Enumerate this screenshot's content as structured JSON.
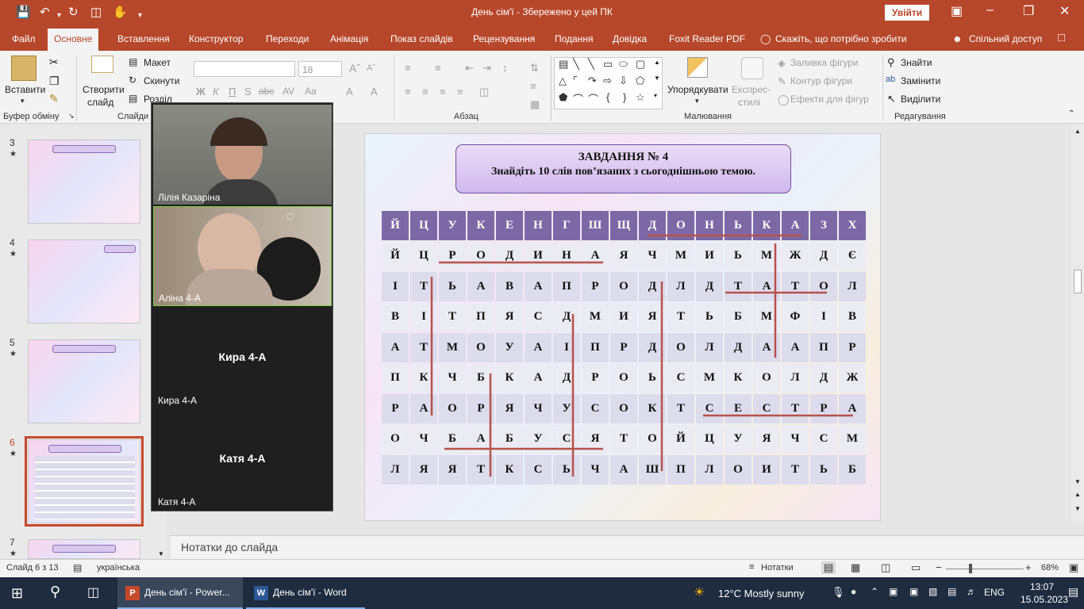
{
  "titlebar": {
    "title": "День сім'ї  -  Збережено у цей ПК",
    "signin_label": "Увійти"
  },
  "ribbon_tabs": [
    {
      "label": "Файл"
    },
    {
      "label": "Основне"
    },
    {
      "label": "Вставлення"
    },
    {
      "label": "Конструктор"
    },
    {
      "label": "Переходи"
    },
    {
      "label": "Анімація"
    },
    {
      "label": "Показ слайдів"
    },
    {
      "label": "Рецензування"
    },
    {
      "label": "Подання"
    },
    {
      "label": "Довідка"
    },
    {
      "label": "Foxit Reader PDF"
    },
    {
      "label": "Скажіть, що потрібно зробити"
    },
    {
      "label": "Спільний доступ"
    }
  ],
  "ribbon": {
    "paste": "Вставити",
    "clipboard_group": "Буфер обміну",
    "new_slide_1": "Створити",
    "new_slide_2": "слайд",
    "layout": "Макет",
    "reset": "Скинути",
    "section": "Розділ",
    "slides_group": "Слайди",
    "font_size": "18",
    "paragraph_group": "Абзац",
    "arrange": "Упорядкувати",
    "quick_styles_1": "Експрес-",
    "quick_styles_2": "стилі",
    "shape_fill": "Заливка фігури",
    "shape_outline": "Контур фігури",
    "shape_effects": "Ефекти для фігур",
    "drawing_group": "Малювання",
    "find": "Знайти",
    "replace": "Замінити",
    "select": "Виділити",
    "editing_group": "Редагування"
  },
  "thumbnails": [
    {
      "num": "3",
      "selected": false
    },
    {
      "num": "4",
      "selected": false
    },
    {
      "num": "5",
      "selected": false
    },
    {
      "num": "6",
      "selected": true
    },
    {
      "num": "7",
      "selected": false
    }
  ],
  "video": {
    "participants": [
      {
        "name": "Лілія Казаріна",
        "camera": true
      },
      {
        "name": "Аліна 4-А",
        "camera": true
      },
      {
        "name": "Кира 4-А",
        "center": "Кира 4-А",
        "camera": false
      },
      {
        "name": "Катя  4-А",
        "center": "Катя  4-А",
        "camera": false
      }
    ]
  },
  "slide": {
    "task_title": "ЗАВДАННЯ № 4",
    "task_subtitle": "Знайдіть 10 слів пов’язаних з сьогоднішньою темою.",
    "grid": [
      [
        "Й",
        "Ц",
        "У",
        "К",
        "Е",
        "Н",
        "Г",
        "Ш",
        "Щ",
        "Д",
        "О",
        "Н",
        "Ь",
        "К",
        "А",
        "З",
        "Х"
      ],
      [
        "Й",
        "Ц",
        "Р",
        "О",
        "Д",
        "И",
        "Н",
        "А",
        "Я",
        "Ч",
        "М",
        "И",
        "Ь",
        "М",
        "Ж",
        "Д",
        "Є"
      ],
      [
        "І",
        "Т",
        "Ь",
        "А",
        "В",
        "А",
        "П",
        "Р",
        "О",
        "Д",
        "Л",
        "Д",
        "Т",
        "А",
        "Т",
        "О",
        "Л"
      ],
      [
        "В",
        "І",
        "Т",
        "П",
        "Я",
        "С",
        "Д",
        "М",
        "И",
        "Я",
        "Т",
        "Ь",
        "Б",
        "М",
        "Ф",
        "І",
        "В"
      ],
      [
        "А",
        "Т",
        "М",
        "О",
        "У",
        "А",
        "І",
        "П",
        "Р",
        "Д",
        "О",
        "Л",
        "Д",
        "А",
        "А",
        "П",
        "Р"
      ],
      [
        "П",
        "К",
        "Ч",
        "Б",
        "К",
        "А",
        "Д",
        "Р",
        "О",
        "Ь",
        "С",
        "М",
        "К",
        "О",
        "Л",
        "Д",
        "Ж"
      ],
      [
        "Р",
        "А",
        "О",
        "Р",
        "Я",
        "Ч",
        "У",
        "С",
        "О",
        "К",
        "Т",
        "С",
        "Е",
        "С",
        "Т",
        "Р",
        "А"
      ],
      [
        "О",
        "Ч",
        "Б",
        "А",
        "Б",
        "У",
        "С",
        "Я",
        "Т",
        "О",
        "Й",
        "Ц",
        "У",
        "Я",
        "Ч",
        "С",
        "М"
      ],
      [
        "Л",
        "Я",
        "Я",
        "Т",
        "К",
        "С",
        "Ь",
        "Ч",
        "А",
        "Ш",
        "П",
        "Л",
        "О",
        "И",
        "Т",
        "Ь",
        "Б"
      ]
    ],
    "line_color": "#b5524d"
  },
  "notes": {
    "placeholder": "Нотатки до слайда"
  },
  "statusbar": {
    "slide_info": "Слайд 6 з 13",
    "language": "українська",
    "notes_label": "Нотатки",
    "zoom": "68%"
  },
  "taskbar": {
    "apps": [
      {
        "label": "День сім'ї - Power...",
        "icon": "powerpoint-icon"
      },
      {
        "label": "День сім'ї - Word",
        "icon": "word-icon"
      }
    ],
    "weather": "12°C  Mostly sunny",
    "lang": "ENG",
    "time": "13:07",
    "date": "15.05.2023"
  }
}
